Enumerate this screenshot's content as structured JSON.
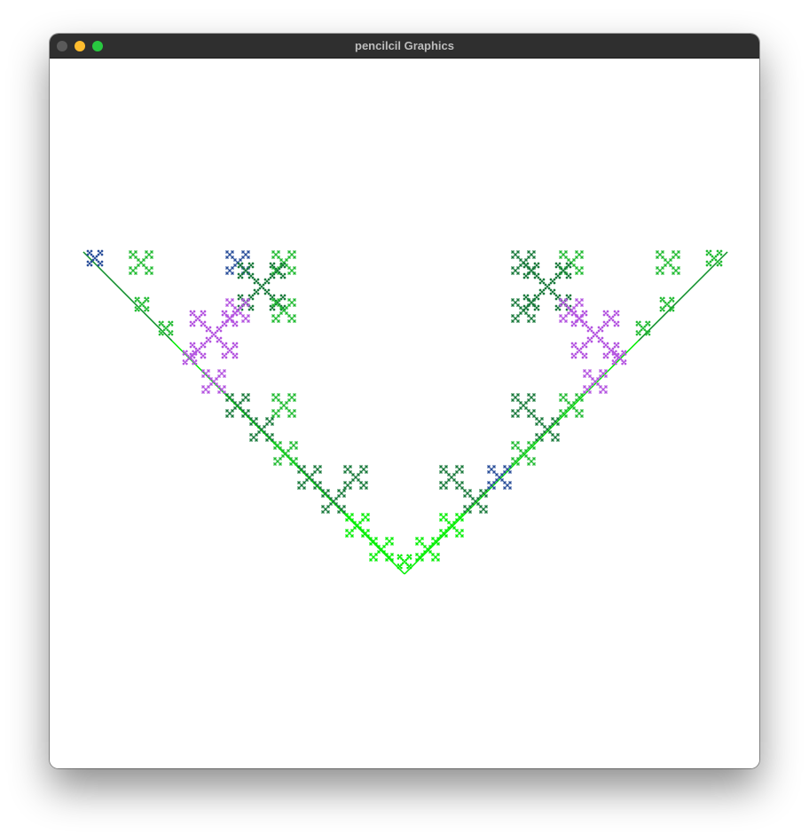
{
  "window": {
    "title": "pencilcil Graphics",
    "buttons": {
      "close": {
        "icon": "close-icon",
        "color": "#5a5a5a"
      },
      "minimize": {
        "icon": "minimize-icon",
        "color": "#febc2e"
      },
      "zoom": {
        "icon": "zoom-icon",
        "color": "#28c840"
      }
    }
  },
  "canvas": {
    "background": "#ffffff",
    "palette": {
      "bright_green": "#00ee00",
      "green": "#22bb33",
      "dark_green": "#1a7a3c",
      "purple": "#b455e0",
      "blue": "#2a4f9a"
    }
  }
}
